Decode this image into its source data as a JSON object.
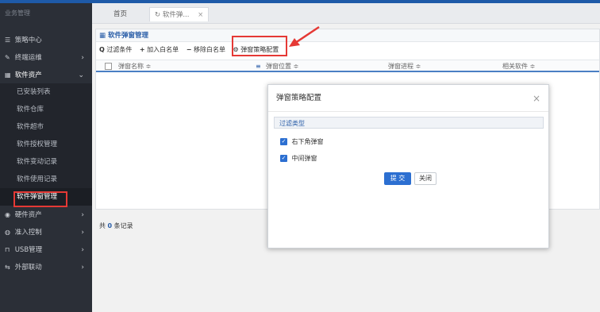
{
  "sidebar": {
    "brand": "业务管理",
    "items": [
      {
        "label": "策略中心",
        "icon": "list-icon",
        "glyph": "☰"
      },
      {
        "label": "终端运维",
        "icon": "edit-icon",
        "glyph": "✎",
        "arrow": "›"
      },
      {
        "label": "软件资产",
        "icon": "grid-icon",
        "glyph": "▦",
        "arrow": "⌄"
      },
      {
        "label": "硬件资产",
        "icon": "circle-icon",
        "glyph": "◉",
        "arrow": "›"
      },
      {
        "label": "准入控制",
        "icon": "globe-icon",
        "glyph": "◍",
        "arrow": "›"
      },
      {
        "label": "USB管理",
        "icon": "usb-icon",
        "glyph": "⊓",
        "arrow": "›"
      },
      {
        "label": "外部联动",
        "icon": "link-icon",
        "glyph": "⇆",
        "arrow": "›"
      }
    ],
    "sub_items": [
      "已安装列表",
      "软件仓库",
      "软件超市",
      "软件授权管理",
      "软件变动记录",
      "软件使用记录",
      "软件弹窗管理"
    ]
  },
  "tabs": {
    "home": "首页",
    "active_icon": "↻",
    "active": "软件弹...",
    "close": "×"
  },
  "panel": {
    "title_icon": "▦",
    "title": "软件弹窗管理",
    "toolbar": [
      {
        "icon": "Q",
        "label": "过滤条件"
      },
      {
        "icon": "+",
        "label": "加入白名单"
      },
      {
        "icon": "−",
        "label": "移除白名单"
      },
      {
        "icon": "⚙",
        "label": "弹窗策略配置"
      }
    ],
    "columns": [
      "弹窗名称 ≑",
      "弹窗位置 ≑",
      "弹窗进程 ≑",
      "相关软件 ≑"
    ],
    "columns_icon": "≡",
    "footer_prefix": "共",
    "footer_count": "0",
    "footer_suffix": "条记录"
  },
  "modal": {
    "title": "弹窗策略配置",
    "close": "×",
    "filter_label": "过滤类型",
    "options": [
      {
        "label": "右下角弹窗",
        "checked": true
      },
      {
        "label": "中间弹窗",
        "checked": true
      }
    ],
    "check_glyph": "✓",
    "submit": "提 交",
    "cancel": "关闭"
  },
  "colors": {
    "accent": "#2c6fd1",
    "highlight": "#e53935",
    "sidebar_bg": "#2b2f37"
  }
}
